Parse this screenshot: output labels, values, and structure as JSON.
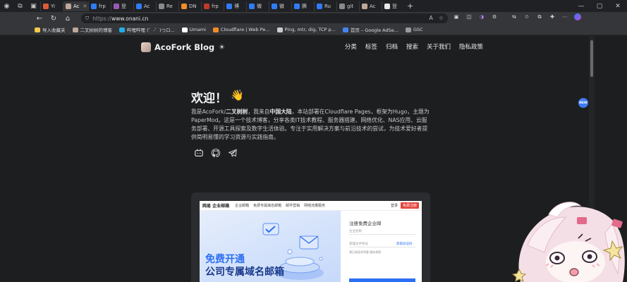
{
  "browser": {
    "tabs": [
      {
        "label": "Yi",
        "color": "#e05a3a"
      },
      {
        "label": "Ac",
        "color": "#bfa89a",
        "active": true
      },
      {
        "label": "frp",
        "color": "#2f7cf6"
      },
      {
        "label": "登",
        "color": "#9b59b6"
      },
      {
        "label": "Ac",
        "color": "#2f7cf6"
      },
      {
        "label": "Re",
        "color": "#8a8a8a"
      },
      {
        "label": "DN",
        "color": "#f28c28"
      },
      {
        "label": "frp",
        "color": "#c0392b"
      },
      {
        "label": "博",
        "color": "#2f7cf6"
      },
      {
        "label": "微",
        "color": "#2f7cf6"
      },
      {
        "label": "微",
        "color": "#2f7cf6"
      },
      {
        "label": "腾",
        "color": "#2f7cf6"
      },
      {
        "label": "Ru",
        "color": "#2f7cf6"
      },
      {
        "label": "git",
        "color": "#8a8a8a"
      },
      {
        "label": "Ac",
        "color": "#bfa89a"
      },
      {
        "label": "登",
        "color": "#e8e8e8"
      }
    ],
    "new_tab_label": "+",
    "url_scheme": "https://",
    "url_host": "www.onani.cn",
    "bookmarks": [
      {
        "label": "导入收藏夹",
        "color": "#f2c94c"
      },
      {
        "label": "二叉树树的博客",
        "color": "#bfa89a"
      },
      {
        "label": "哔哩哔哩 (゜-゜)つロ...",
        "color": "#23ade5"
      },
      {
        "label": "Umami",
        "color": "#ffffff"
      },
      {
        "label": "Cloudflare | Web Pe...",
        "color": "#f28c28"
      },
      {
        "label": "Ping, mtr, dig, TCP p...",
        "color": "#cccccc"
      },
      {
        "label": "首页 – Google AdSe...",
        "color": "#4285f4"
      },
      {
        "label": "GSC",
        "color": "#9a9a9a"
      }
    ]
  },
  "site": {
    "title": "AcoFork Blog",
    "theme_icon": "☀",
    "nav": [
      "分类",
      "标签",
      "归档",
      "搜索",
      "关于我们",
      "隐私政策"
    ],
    "hero_title": "欢迎！",
    "hero_emoji": "👋",
    "hero_text_1": "我是AcoFork/",
    "hero_bold_1": "二叉树树",
    "hero_text_2": "，我来自",
    "hero_bold_2": "中国大陆",
    "hero_text_3": "，本站部署在Cloudflare Pages，框架为Hugo，主题为PaperMod。这是一个技术博客，分享各类IT技术教程、服务器搭建、网络优化、NAS应用、云服务部署、开源工具探索及数字生活体验。专注于实用解决方案与前沿技术的尝试，为技术爱好者提供简明易懂的学习资源与实践指南。"
  },
  "card": {
    "logo": "网易 企业邮箱",
    "nav_items": [
      "企业邮箱",
      "免费专属域名邮箱",
      "邮件营销",
      "网络流量服务"
    ],
    "login": "登录",
    "register": "免费注册",
    "banner_line1": "免费开通",
    "banner_line2": "公司专属域名邮箱",
    "form_title": "注册免费企业邮",
    "form_ph1": "企业名称",
    "form_ph2": "管理员手机号",
    "form_link": "获取验证码",
    "form_agree": "我已阅读并同意 服务条款"
  },
  "float_badge": "NEW"
}
